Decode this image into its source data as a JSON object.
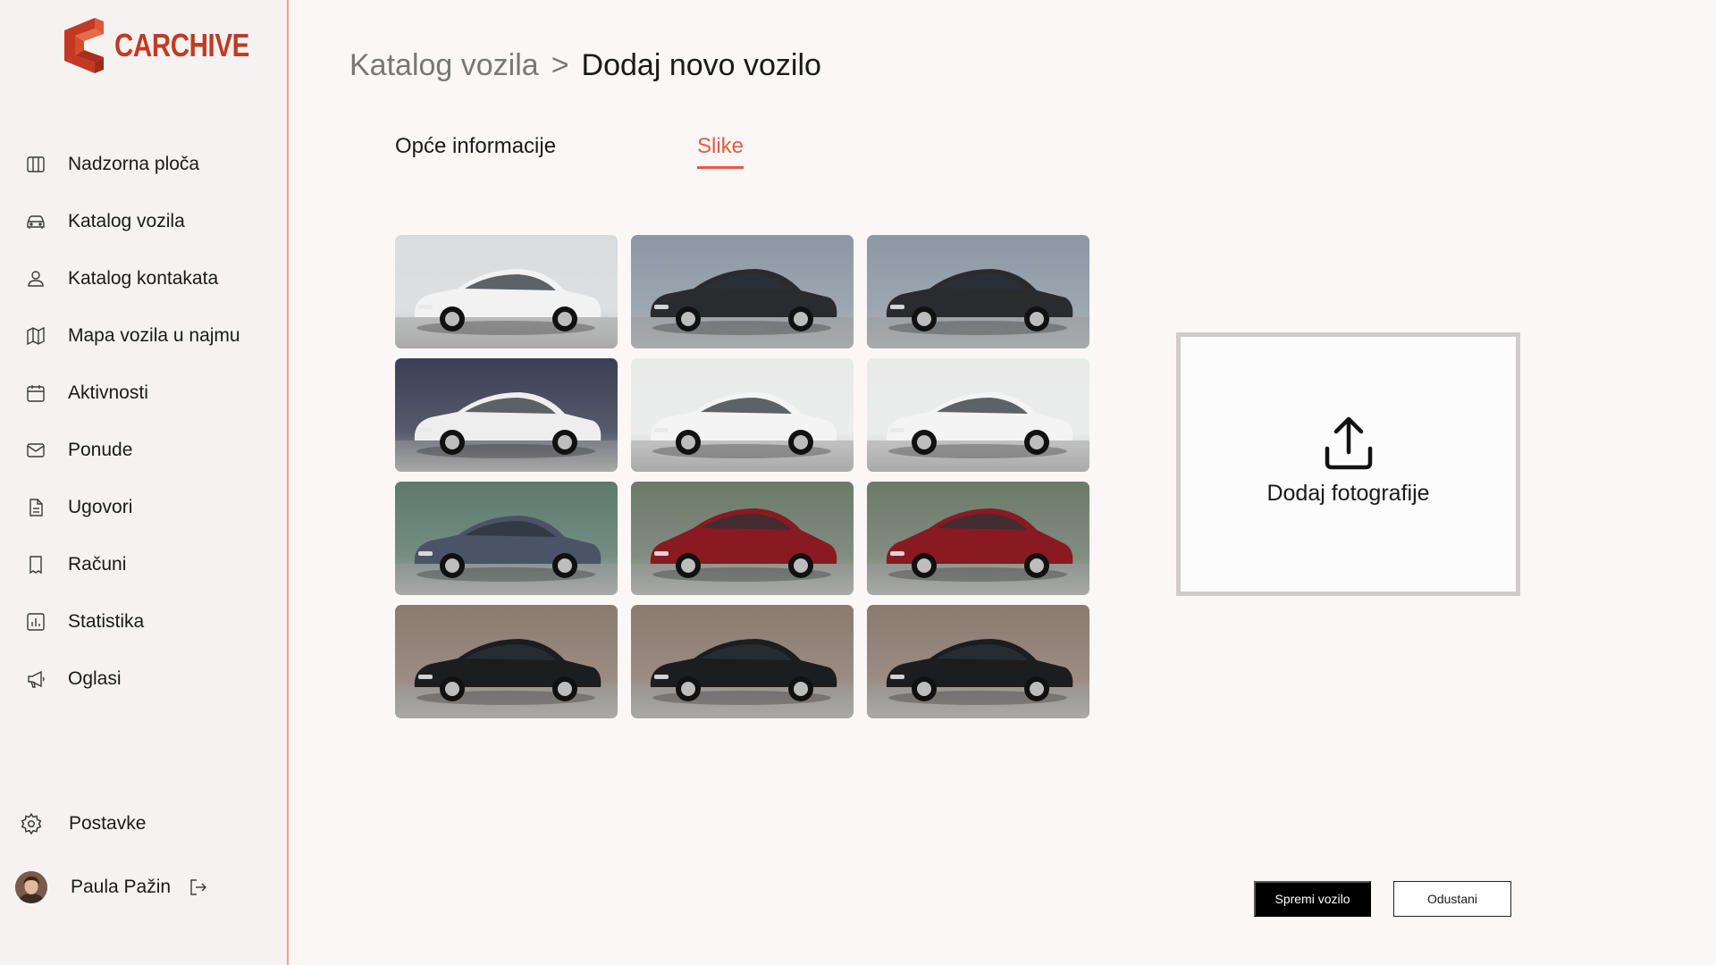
{
  "app": {
    "brand": "CARCHIVE",
    "brand_color": "#c23a23",
    "accent_color": "#e55a40"
  },
  "sidebar": {
    "items": [
      {
        "label": "Nadzorna ploča",
        "icon": "dashboard-icon"
      },
      {
        "label": "Katalog vozila",
        "icon": "car-icon"
      },
      {
        "label": "Katalog kontakata",
        "icon": "user-icon"
      },
      {
        "label": "Mapa vozila u najmu",
        "icon": "map-icon"
      },
      {
        "label": "Aktivnosti",
        "icon": "calendar-icon"
      },
      {
        "label": "Ponude",
        "icon": "mail-icon"
      },
      {
        "label": "Ugovori",
        "icon": "document-icon"
      },
      {
        "label": "Računi",
        "icon": "receipt-icon"
      },
      {
        "label": "Statistika",
        "icon": "chart-icon"
      },
      {
        "label": "Oglasi",
        "icon": "megaphone-icon"
      }
    ],
    "settings_label": "Postavke",
    "user_name": "Paula Pažin"
  },
  "breadcrumb": {
    "parent": "Katalog vozila",
    "separator": ">",
    "current": "Dodaj novo vozilo"
  },
  "tabs": {
    "general": "Opće informacije",
    "images": "Slike",
    "active": "images"
  },
  "photos": [
    {
      "car": "white-sedan-bmw",
      "body": "#f2f2f2",
      "bg": "#d9dbdd"
    },
    {
      "car": "black-coupe-mercedes",
      "body": "#2a2b2e",
      "bg": "#8d98a4"
    },
    {
      "car": "black-coupe-mercedes",
      "body": "#2a2b2e",
      "bg": "#8d98a4"
    },
    {
      "car": "white-sedan-audi",
      "body": "#eeeeee",
      "bg": "#3b3f55"
    },
    {
      "car": "white-sedan-toyota",
      "body": "#f4f4f4",
      "bg": "#e9eaea"
    },
    {
      "car": "white-sedan-toyota",
      "body": "#f4f4f4",
      "bg": "#e9eaea"
    },
    {
      "car": "grey-sedan-audi",
      "body": "#4a5466",
      "bg": "#5d7a6e"
    },
    {
      "car": "red-suv-toyota",
      "body": "#8a1a22",
      "bg": "#6c7a6a"
    },
    {
      "car": "red-suv-toyota",
      "body": "#8a1a22",
      "bg": "#6c7a6a"
    },
    {
      "car": "black-sedan-mercedes",
      "body": "#1c1d1f",
      "bg": "#8a7a70"
    },
    {
      "car": "black-sedan-mercedes",
      "body": "#1c1d1f",
      "bg": "#8a7a70"
    },
    {
      "car": "black-sedan-mercedes",
      "body": "#1c1d1f",
      "bg": "#8a7a70"
    }
  ],
  "upload": {
    "label": "Dodaj fotografije",
    "icon": "upload-icon"
  },
  "actions": {
    "save_label": "Spremi vozilo",
    "cancel_label": "Odustani"
  }
}
